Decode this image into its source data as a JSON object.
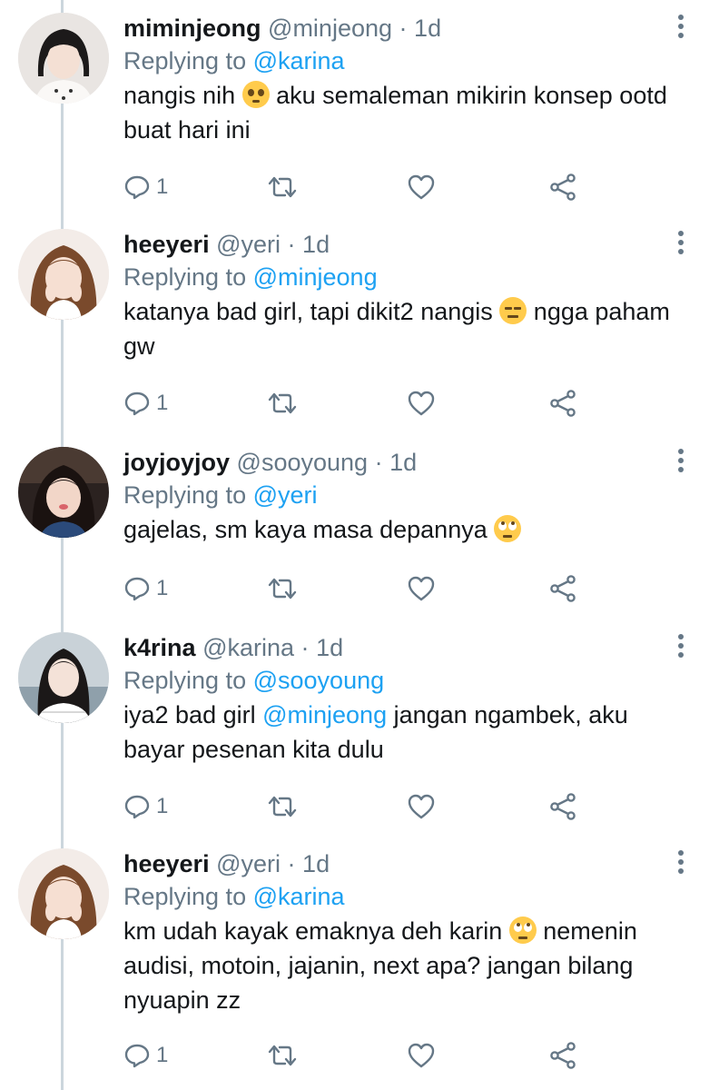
{
  "colors": {
    "text": "#14171a",
    "secondary": "#657786",
    "link": "#1da1f2",
    "thread_line": "#ccd6dd"
  },
  "replies": [
    {
      "name": "miminjeong",
      "handle": "@minjeong",
      "dot": "·",
      "time": "1d",
      "replying_prefix": "Replying to",
      "replying_to": "@karina",
      "text_1": "nangis nih",
      "emoji_1": "pleading-face",
      "text_2": "aku semaleman mikirin konsep ootd buat hari ini",
      "reply_count": "1"
    },
    {
      "name": "heeyeri",
      "handle": "@yeri",
      "dot": "·",
      "time": "1d",
      "replying_prefix": "Replying to",
      "replying_to": "@minjeong",
      "text_1": "katanya bad girl, tapi dikit2 nangis",
      "emoji_1": "expressionless-face",
      "text_2": "ngga paham gw",
      "reply_count": "1"
    },
    {
      "name": "joyjoyjoy",
      "handle": "@sooyoung",
      "dot": "·",
      "time": "1d",
      "replying_prefix": "Replying to",
      "replying_to": "@yeri",
      "text_1": "gajelas, sm kaya masa depannya",
      "emoji_1": "rolling-eyes-face",
      "reply_count": "1"
    },
    {
      "name": "k4rina",
      "handle": "@karina",
      "dot": "·",
      "time": "1d",
      "replying_prefix": "Replying to",
      "replying_to": "@sooyoung",
      "text_1": "iya2 bad girl",
      "mention": "@minjeong",
      "text_2": "jangan ngambek, aku bayar pesenan kita dulu",
      "reply_count": "1"
    },
    {
      "name": "heeyeri",
      "handle": "@yeri",
      "dot": "·",
      "time": "1d",
      "replying_prefix": "Replying to",
      "replying_to": "@karina",
      "text_1": "km udah kayak emaknya deh karin",
      "emoji_1": "rolling-eyes-face",
      "text_2": "nemenin audisi, motoin, jajanin, next apa? jangan bilang nyuapin zz",
      "reply_count": "1"
    }
  ]
}
